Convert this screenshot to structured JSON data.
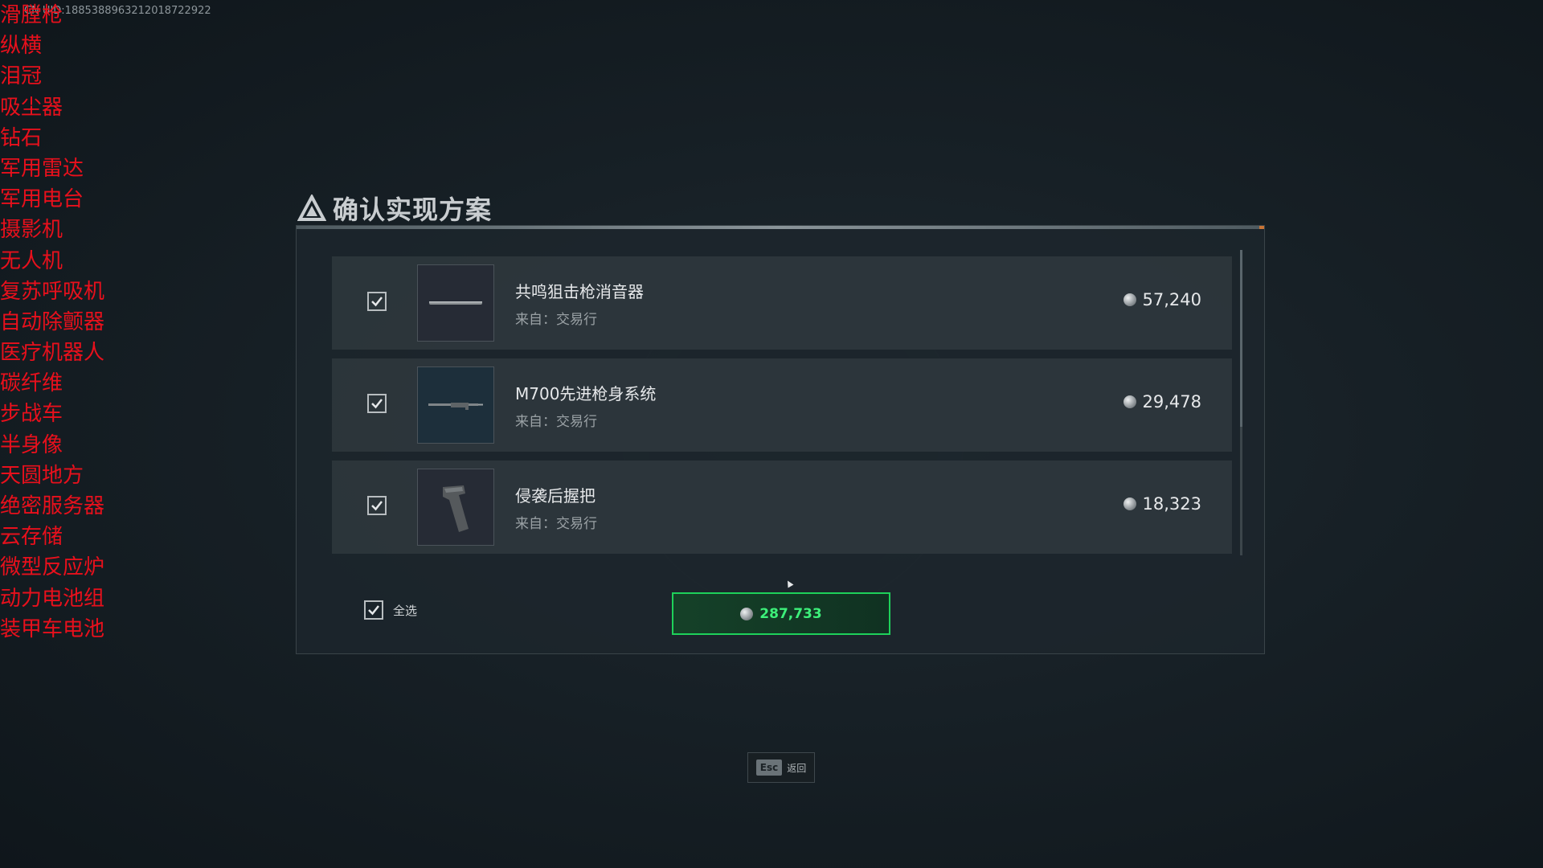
{
  "uid_text": "CN UID:1885388963212018722922",
  "overlay_list": [
    "滑膛枪",
    "纵横",
    "泪冠",
    "吸尘器",
    "钻石",
    "军用雷达",
    "军用电台",
    "摄影机",
    "无人机",
    "复苏呼吸机",
    "自动除颤器",
    "医疗机器人",
    "碳纤维",
    "步战车",
    "半身像",
    "天圆地方",
    "绝密服务器",
    "云存储",
    "微型反应炉",
    "动力电池组",
    "装甲车电池"
  ],
  "dialog": {
    "title": "确认实现方案",
    "title_icon": "warning-triangle-icon",
    "items": [
      {
        "name": "共鸣狙击枪消音器",
        "source_label": "来自：",
        "source": "交易行",
        "price": "57,240",
        "checked": true,
        "icon": "suppressor-icon"
      },
      {
        "name": "M700先进枪身系统",
        "source_label": "来自：",
        "source": "交易行",
        "price": "29,478",
        "checked": true,
        "icon": "rifle-body-icon"
      },
      {
        "name": "侵袭后握把",
        "source_label": "来自：",
        "source": "交易行",
        "price": "18,323",
        "checked": true,
        "icon": "grip-icon"
      }
    ],
    "select_all_label": "全选",
    "select_all_checked": true,
    "total": "287,733"
  },
  "esc_hint": {
    "key": "Esc",
    "label": "返回"
  },
  "colors": {
    "overlay_text": "#e8101c",
    "confirm_border": "#1ed15a",
    "total_text": "#3df07a"
  }
}
